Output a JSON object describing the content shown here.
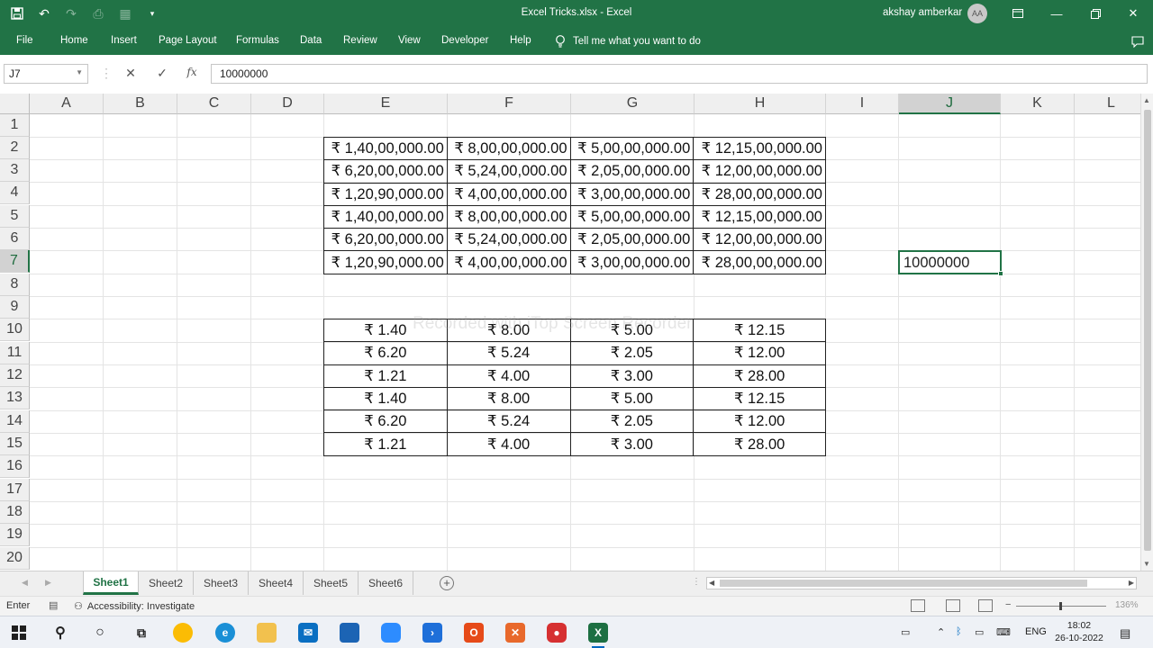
{
  "window": {
    "title": "Excel Tricks.xlsx  -  Excel",
    "user_name": "akshay amberkar",
    "user_initials": "AA"
  },
  "ribbon": {
    "tabs": [
      "File",
      "Home",
      "Insert",
      "Page Layout",
      "Formulas",
      "Data",
      "Review",
      "View",
      "Developer",
      "Help"
    ],
    "tell_me": "Tell me what you want to do"
  },
  "formula_bar": {
    "name_box": "J7",
    "cancel_icon": "✕",
    "enter_icon": "✓",
    "fx_label": "fx",
    "content": "10000000"
  },
  "grid": {
    "columns": [
      "A",
      "B",
      "C",
      "D",
      "E",
      "F",
      "G",
      "H",
      "I",
      "J",
      "K",
      "L"
    ],
    "selected_column": "J",
    "rows": [
      "1",
      "2",
      "3",
      "4",
      "5",
      "6",
      "7",
      "8",
      "9",
      "10",
      "11",
      "12",
      "13",
      "14",
      "15",
      "16",
      "17",
      "18",
      "19",
      "20"
    ],
    "selected_row": "7",
    "table1": [
      [
        "₹ 1,40,00,000.00",
        "₹ 8,00,00,000.00",
        "₹ 5,00,00,000.00",
        "₹ 12,15,00,000.00"
      ],
      [
        "₹ 6,20,00,000.00",
        "₹ 5,24,00,000.00",
        "₹ 2,05,00,000.00",
        "₹ 12,00,00,000.00"
      ],
      [
        "₹ 1,20,90,000.00",
        "₹ 4,00,00,000.00",
        "₹ 3,00,00,000.00",
        "₹ 28,00,00,000.00"
      ],
      [
        "₹ 1,40,00,000.00",
        "₹ 8,00,00,000.00",
        "₹ 5,00,00,000.00",
        "₹ 12,15,00,000.00"
      ],
      [
        "₹ 6,20,00,000.00",
        "₹ 5,24,00,000.00",
        "₹ 2,05,00,000.00",
        "₹ 12,00,00,000.00"
      ],
      [
        "₹ 1,20,90,000.00",
        "₹ 4,00,00,000.00",
        "₹ 3,00,00,000.00",
        "₹ 28,00,00,000.00"
      ]
    ],
    "table2": [
      [
        "₹ 1.40",
        "₹ 8.00",
        "₹ 5.00",
        "₹ 12.15"
      ],
      [
        "₹ 6.20",
        "₹ 5.24",
        "₹ 2.05",
        "₹ 12.00"
      ],
      [
        "₹ 1.21",
        "₹ 4.00",
        "₹ 3.00",
        "₹ 28.00"
      ],
      [
        "₹ 1.40",
        "₹ 8.00",
        "₹ 5.00",
        "₹ 12.15"
      ],
      [
        "₹ 6.20",
        "₹ 5.24",
        "₹ 2.05",
        "₹ 12.00"
      ],
      [
        "₹ 1.21",
        "₹ 4.00",
        "₹ 3.00",
        "₹ 28.00"
      ]
    ],
    "active_cell_value": "10000000",
    "watermark": "Recorded with iTop Screen Recorder"
  },
  "sheets": {
    "tabs": [
      "Sheet1",
      "Sheet2",
      "Sheet3",
      "Sheet4",
      "Sheet5",
      "Sheet6"
    ],
    "active": "Sheet1"
  },
  "status_bar": {
    "mode": "Enter",
    "accessibility": "Accessibility: Investigate",
    "zoom": "136%"
  },
  "taskbar": {
    "language": "ENG",
    "time": "18:02",
    "date": "26-10-2022"
  },
  "colors": {
    "excel_green": "#217346",
    "grid_line": "#e4e4e4"
  }
}
